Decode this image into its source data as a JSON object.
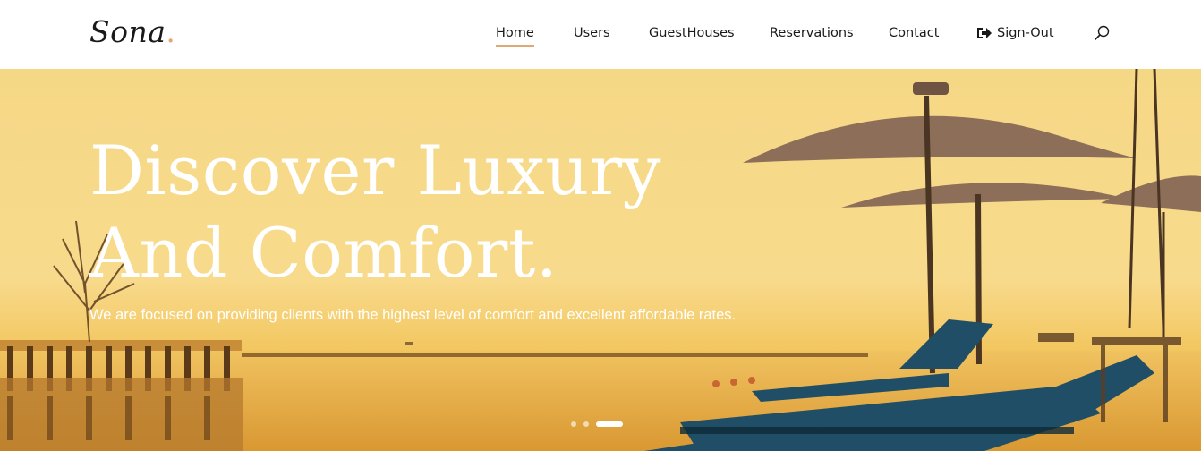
{
  "header": {
    "logo_text": "Sona",
    "logo_dot": ".",
    "nav": {
      "home": "Home",
      "users": "Users",
      "guesthouses": "GuestHouses",
      "reservations": "Reservations",
      "contact": "Contact",
      "signout": "Sign-Out"
    },
    "active_item": "Home",
    "icons": {
      "signout": "sign-out-icon",
      "search": "search-icon"
    }
  },
  "hero": {
    "title_line1": "Discover Luxury",
    "title_line2": "And Comfort.",
    "subtitle": "We are focused on providing clients with the highest level of comfort and excellent affordable rates.",
    "carousel_slide_count": 3,
    "carousel_active_index": 2
  },
  "colors": {
    "accent": "#dfa974",
    "text_dark": "#19191a",
    "hero_text": "#ffffff"
  }
}
